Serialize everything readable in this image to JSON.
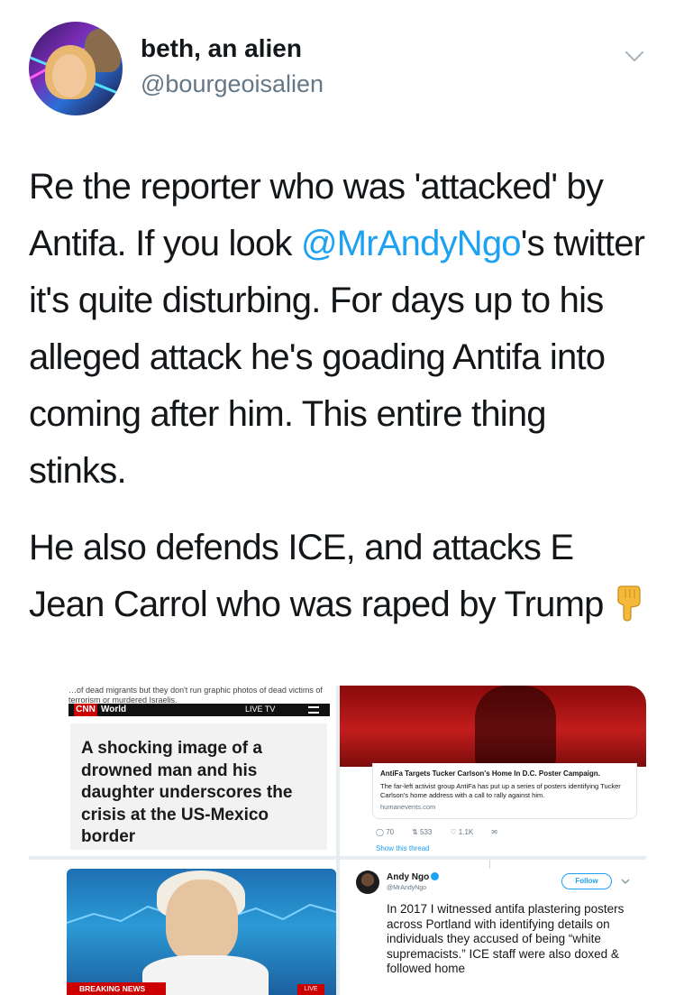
{
  "tweet": {
    "author_name": "beth, an alien",
    "author_handle": "@bourgeoisalien",
    "text_p1_a": "Re the reporter who was 'attacked' by Antifa. If you look ",
    "text_p1_mention": "@MrAndyNgo",
    "text_p1_b": "'s twitter it's quite disturbing. For days up to his alleged attack he's goading Antifa into coming after him. This entire thing stinks.",
    "text_p2": "He also defends ICE, and attacks E Jean Carrol who was raped by Trump",
    "emoji_icon": "backhand-index-pointing-down-icon"
  },
  "media": {
    "tile1": {
      "top_note_line1": "…of dead migrants but they don't run graphic photos of dead victims of",
      "top_note_line2": "terrorism or murdered Israelis.",
      "cnn_logo": "CNN",
      "section": "World",
      "live_tv": "LIVE TV",
      "headline": "A shocking image of a drowned man and his daughter underscores the crisis at the US-Mexico border"
    },
    "tile2": {
      "card_title": "AntiFa Targets Tucker Carlson's Home In D.C. Poster Campaign.",
      "card_desc": "The far-left activist group AntiFa has put up a series of posters identifying Tucker Carlson's home address with a call to rally against him.",
      "card_url": "humanevents.com",
      "replies": "70",
      "retweets": "533",
      "likes": "1.1K",
      "show_thread": "Show this thread"
    },
    "tile3": {
      "breaking": "BREAKING NEWS",
      "live": "LIVE"
    },
    "tile4": {
      "name": "Andy Ngo",
      "handle": "@MrAndyNgo",
      "follow": "Follow",
      "body": "In 2017 I witnessed antifa plastering posters across Portland with identifying details on individuals they accused of being “white supremacists.” ICE staff were also doxed & followed home"
    }
  }
}
